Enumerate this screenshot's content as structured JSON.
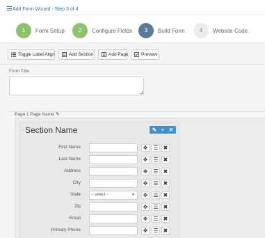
{
  "titlebar": {
    "title": "Add Form Wizard - Step 3 of 4"
  },
  "steps": [
    {
      "number": "1",
      "label": "Form Setup",
      "state": "completed",
      "color": "#8cc26c"
    },
    {
      "number": "2",
      "label": "Configure Fields",
      "state": "completed",
      "color": "#8cc26c"
    },
    {
      "number": "3",
      "label": "Build Form",
      "state": "active",
      "color": "#5a7c98"
    },
    {
      "number": "4",
      "label": "Website Code",
      "state": "pending",
      "color": "#ececec"
    }
  ],
  "toolbar": {
    "toggle_label": "Toggle Label Align",
    "add_section_label": "Add Section",
    "add_page_label": "Add Page",
    "preview_label": "Preview"
  },
  "form_title": {
    "label": "Form Title",
    "value": ""
  },
  "page": {
    "name_label": "Page 1 Page Name"
  },
  "section": {
    "title": "Section Name",
    "tools_color": "#3f8fd6",
    "fields": [
      {
        "label": "First Name",
        "type": "text",
        "value": ""
      },
      {
        "label": "Last Name",
        "type": "text",
        "value": ""
      },
      {
        "label": "Address",
        "type": "text",
        "value": ""
      },
      {
        "label": "City",
        "type": "text",
        "value": ""
      },
      {
        "label": "State",
        "type": "select",
        "value": "- select -"
      },
      {
        "label": "Zip",
        "type": "text",
        "value": ""
      },
      {
        "label": "Email",
        "type": "text",
        "value": ""
      },
      {
        "label": "Primary Phone",
        "type": "text",
        "value": ""
      }
    ]
  },
  "icons": {
    "menu": "hamburger-icon",
    "pencil": "pencil-icon",
    "move": "move-icon",
    "list": "list-icon",
    "remove": "close-icon",
    "add": "plus-icon"
  }
}
